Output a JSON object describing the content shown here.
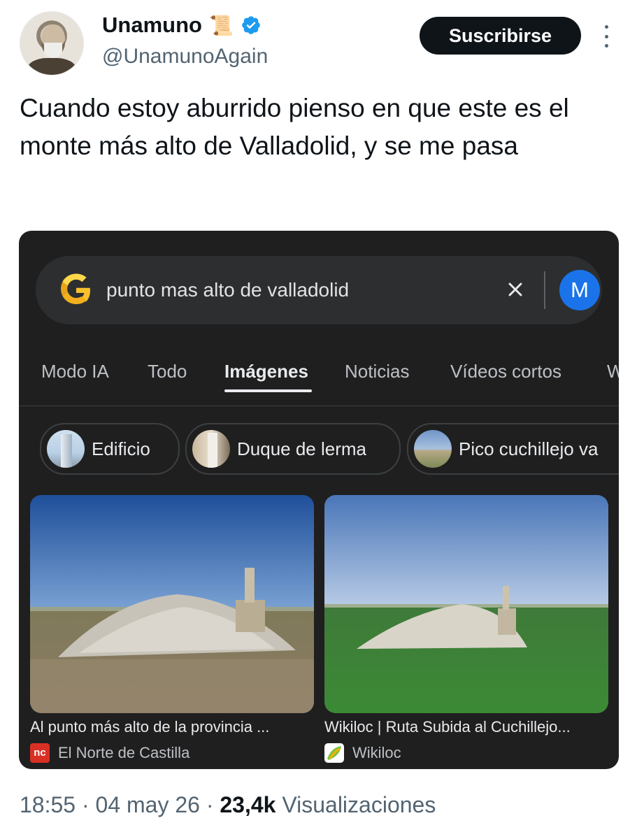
{
  "tweet": {
    "author_name": "Unamuno",
    "author_emoji": "📜",
    "handle": "@UnamunoAgain",
    "subscribe_label": "Suscribirse",
    "text": "Cuando estoy aburrido pienso en que este es el monte más alto de Valladolid, y se me pasa",
    "time": "18:55",
    "sep1": " · ",
    "date": "04 may 26",
    "sep2": " · ",
    "views_count": "23,4k",
    "views_label": "Visualizaciones"
  },
  "screenshot": {
    "search": {
      "query": "punto mas alto de valladolid",
      "account_initial": "M"
    },
    "tabs": [
      {
        "label": "Modo IA"
      },
      {
        "label": "Todo"
      },
      {
        "label": "Imágenes",
        "active": true
      },
      {
        "label": "Noticias"
      },
      {
        "label": "Vídeos cortos"
      },
      {
        "label": "W"
      }
    ],
    "chips": [
      {
        "label": "Edificio"
      },
      {
        "label": "Duque de lerma"
      },
      {
        "label": "Pico cuchillejo va"
      }
    ],
    "results": [
      {
        "caption": "Al punto más alto de la provincia ...",
        "source": "El Norte de Castilla",
        "favicon_text": "nc"
      },
      {
        "caption": "Wikiloc | Ruta Subida al Cuchillejo...",
        "source": "Wikiloc"
      }
    ],
    "colors": {
      "background": "#1f1f1f",
      "search_bar": "#2d2e30",
      "account": "#1a73e8"
    }
  }
}
